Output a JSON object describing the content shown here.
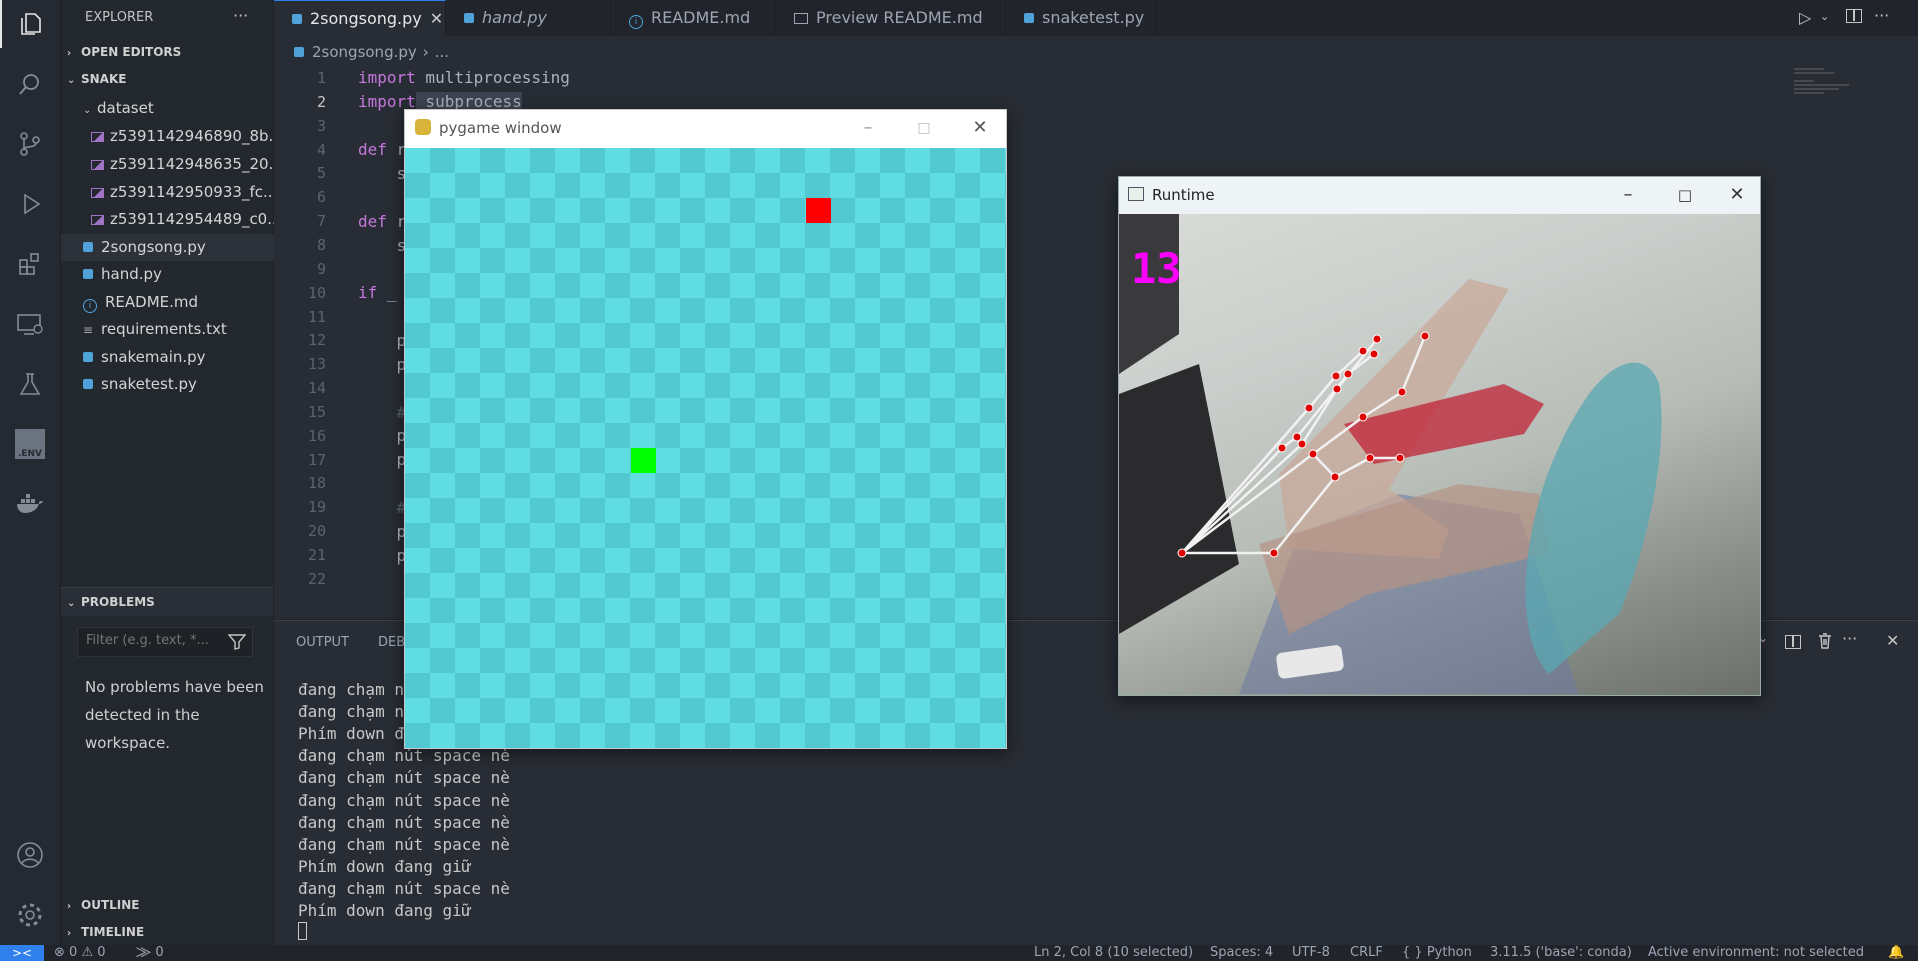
{
  "explorer": {
    "title": "EXPLORER",
    "open_editors": "OPEN EDITORS",
    "folder": "SNAKE",
    "subfolder": "dataset",
    "dataset_files": [
      "z5391142946890_8b...",
      "z5391142948635_20...",
      "z5391142950933_fc...",
      "z5391142954489_c0..."
    ],
    "files": [
      "2songsong.py",
      "hand.py",
      "README.md",
      "requirements.txt",
      "snakemain.py",
      "snaketest.py"
    ],
    "more": "···"
  },
  "problems": {
    "title": "PROBLEMS",
    "filter_placeholder": "Filter (e.g. text, *...",
    "message_lines": [
      "No problems have been",
      "detected in the",
      "workspace."
    ]
  },
  "outline": "OUTLINE",
  "timeline": "TIMELINE",
  "tabs": [
    "2songsong.py",
    "hand.py",
    "README.md",
    "Preview README.md",
    "snaketest.py"
  ],
  "breadcrumb": [
    "2songsong.py",
    "..."
  ],
  "editor": {
    "line_numbers": [
      "1",
      "2",
      "3",
      "4",
      "5",
      "6",
      "7",
      "8",
      "9",
      "10",
      "11",
      "12",
      "13",
      "14",
      "15",
      "16",
      "17",
      "18",
      "19",
      "20",
      "21",
      "22"
    ],
    "line1_kw": "import",
    "line1_rest": " multiprocessing",
    "line2_kw": "import",
    "line2_rest": " subprocess",
    "line4_kw": "def",
    "line4_rest": " r",
    "line5": "    s",
    "line7_kw": "def",
    "line7_rest": " r",
    "line8": "    s",
    "line10_kw": "if",
    "line10_rest": " _",
    "line12": "    p",
    "line13": "    p",
    "line15": "    #",
    "line16": "    p",
    "line17": "    p",
    "line19": "    #",
    "line20": "    p",
    "line21": "    p"
  },
  "panel": {
    "tab_output": "OUTPUT",
    "tab_debug": "DEB",
    "terminal_lines": [
      "đang chạm nú",
      "đang chạm nú",
      "Phím down đa",
      "đang chạm nút space nè",
      "đang chạm nút space nè",
      "đang chạm nút space nè",
      "đang chạm nút space nè",
      "đang chạm nút space nè",
      "Phím down đang giữ",
      "đang chạm nút space nè",
      "Phím down đang giữ"
    ]
  },
  "pygame": {
    "title": "pygame window",
    "board_color": "#5fdde3",
    "food_color": "#ff0000",
    "snake_color": "#00ff00"
  },
  "runtime": {
    "title": "Runtime",
    "counter": "13",
    "counter_color": "#ff00ff"
  },
  "statusbar": {
    "errors": "0",
    "warnings": "0",
    "ports": "0",
    "position": "Ln 2, Col 8 (10 selected)",
    "spaces": "Spaces: 4",
    "encoding": "UTF-8",
    "eol": "CRLF",
    "language": "Python",
    "interpreter": "3.11.5 ('base': conda)",
    "environment": "Active environment: not selected"
  }
}
